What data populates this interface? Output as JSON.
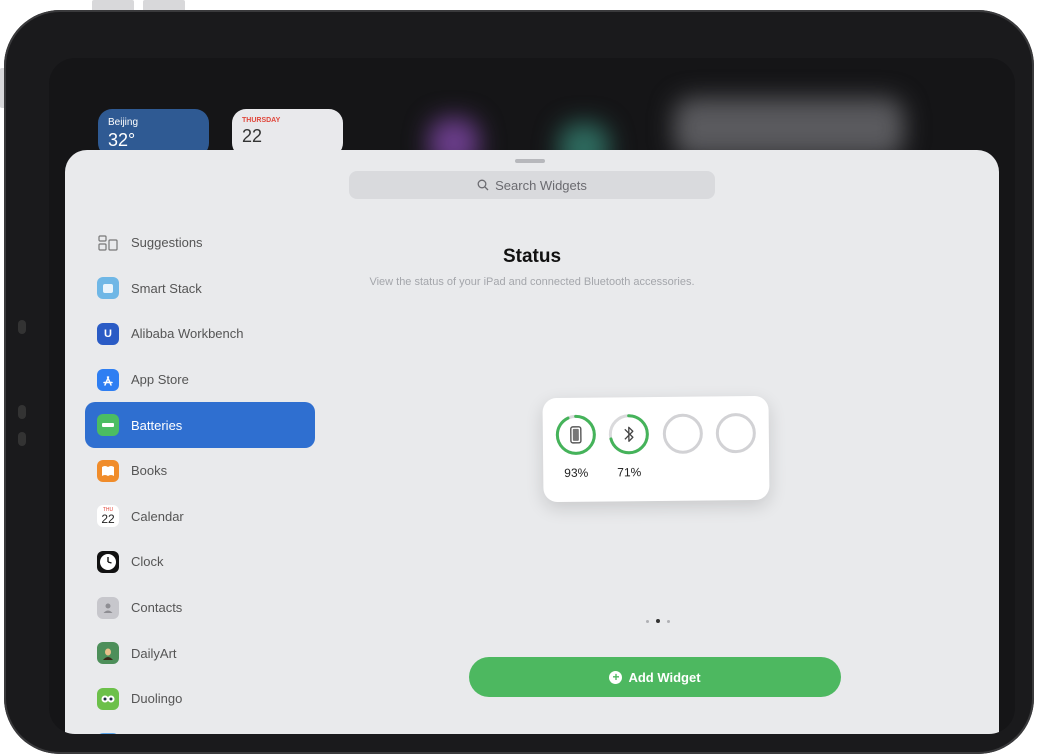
{
  "background_widgets": {
    "weather": {
      "city": "Beijing",
      "temp": "32°"
    },
    "calendar": {
      "day": "THURSDAY",
      "date": "22"
    }
  },
  "search": {
    "placeholder": "Search Widgets"
  },
  "sidebar": {
    "items": [
      {
        "label": "Suggestions",
        "icon": "suggestions-icon"
      },
      {
        "label": "Smart Stack",
        "icon": "smart-stack-icon"
      },
      {
        "label": "Alibaba Workbench",
        "icon": "alibaba-icon"
      },
      {
        "label": "App Store",
        "icon": "app-store-icon"
      },
      {
        "label": "Batteries",
        "icon": "batteries-icon",
        "selected": true
      },
      {
        "label": "Books",
        "icon": "books-icon"
      },
      {
        "label": "Calendar",
        "icon": "calendar-icon",
        "icon_text": "22",
        "icon_sub": "THU"
      },
      {
        "label": "Clock",
        "icon": "clock-icon"
      },
      {
        "label": "Contacts",
        "icon": "contacts-icon"
      },
      {
        "label": "DailyArt",
        "icon": "dailyart-icon"
      },
      {
        "label": "Duolingo",
        "icon": "duolingo-icon"
      }
    ]
  },
  "main": {
    "title": "Status",
    "subtitle": "View the status of your iPad and connected Bluetooth accessories."
  },
  "battery_widget": {
    "devices": [
      {
        "icon": "ipad-icon",
        "percent_label": "93%",
        "level": 0.93
      },
      {
        "icon": "bluetooth-icon",
        "percent_label": "71%",
        "level": 0.71
      },
      {
        "icon": "",
        "percent_label": "",
        "level": 0
      },
      {
        "icon": "",
        "percent_label": "",
        "level": 0
      }
    ],
    "ring_color": "#45b35a"
  },
  "pager": {
    "count": 3,
    "current": 2
  },
  "add_button": {
    "label": "Add Widget"
  },
  "colors": {
    "accent": "#2f6fd0",
    "green": "#4db860"
  }
}
